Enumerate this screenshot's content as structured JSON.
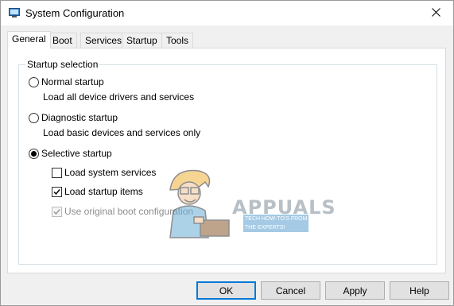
{
  "window": {
    "title": "System Configuration",
    "icon": "msconfig-icon"
  },
  "tabs": [
    {
      "label": "General",
      "active": true
    },
    {
      "label": "Boot",
      "active": false
    },
    {
      "label": "Services",
      "active": false
    },
    {
      "label": "Startup",
      "active": false
    },
    {
      "label": "Tools",
      "active": false
    }
  ],
  "startup_selection": {
    "legend": "Startup selection",
    "normal": {
      "label": "Normal startup",
      "description": "Load all device drivers and services",
      "selected": false
    },
    "diagnostic": {
      "label": "Diagnostic startup",
      "description": "Load basic devices and services only",
      "selected": false
    },
    "selective": {
      "label": "Selective startup",
      "selected": true,
      "options": {
        "system_services": {
          "label": "Load system services",
          "checked": false,
          "enabled": true
        },
        "startup_items": {
          "label": "Load startup items",
          "checked": true,
          "enabled": true
        },
        "original_boot": {
          "label": "Use original boot configuration",
          "checked": true,
          "enabled": false
        }
      }
    }
  },
  "watermark": {
    "brand": "APPUALS",
    "tagline": "TECH HOW-TO'S FROM THE EXPERTS!"
  },
  "buttons": {
    "ok": "OK",
    "cancel": "Cancel",
    "apply": "Apply",
    "help": "Help"
  },
  "colors": {
    "accent": "#0078d7",
    "window_bg": "#f0f0f0",
    "panel_bg": "#ffffff",
    "disabled_text": "#8d8d8d"
  }
}
